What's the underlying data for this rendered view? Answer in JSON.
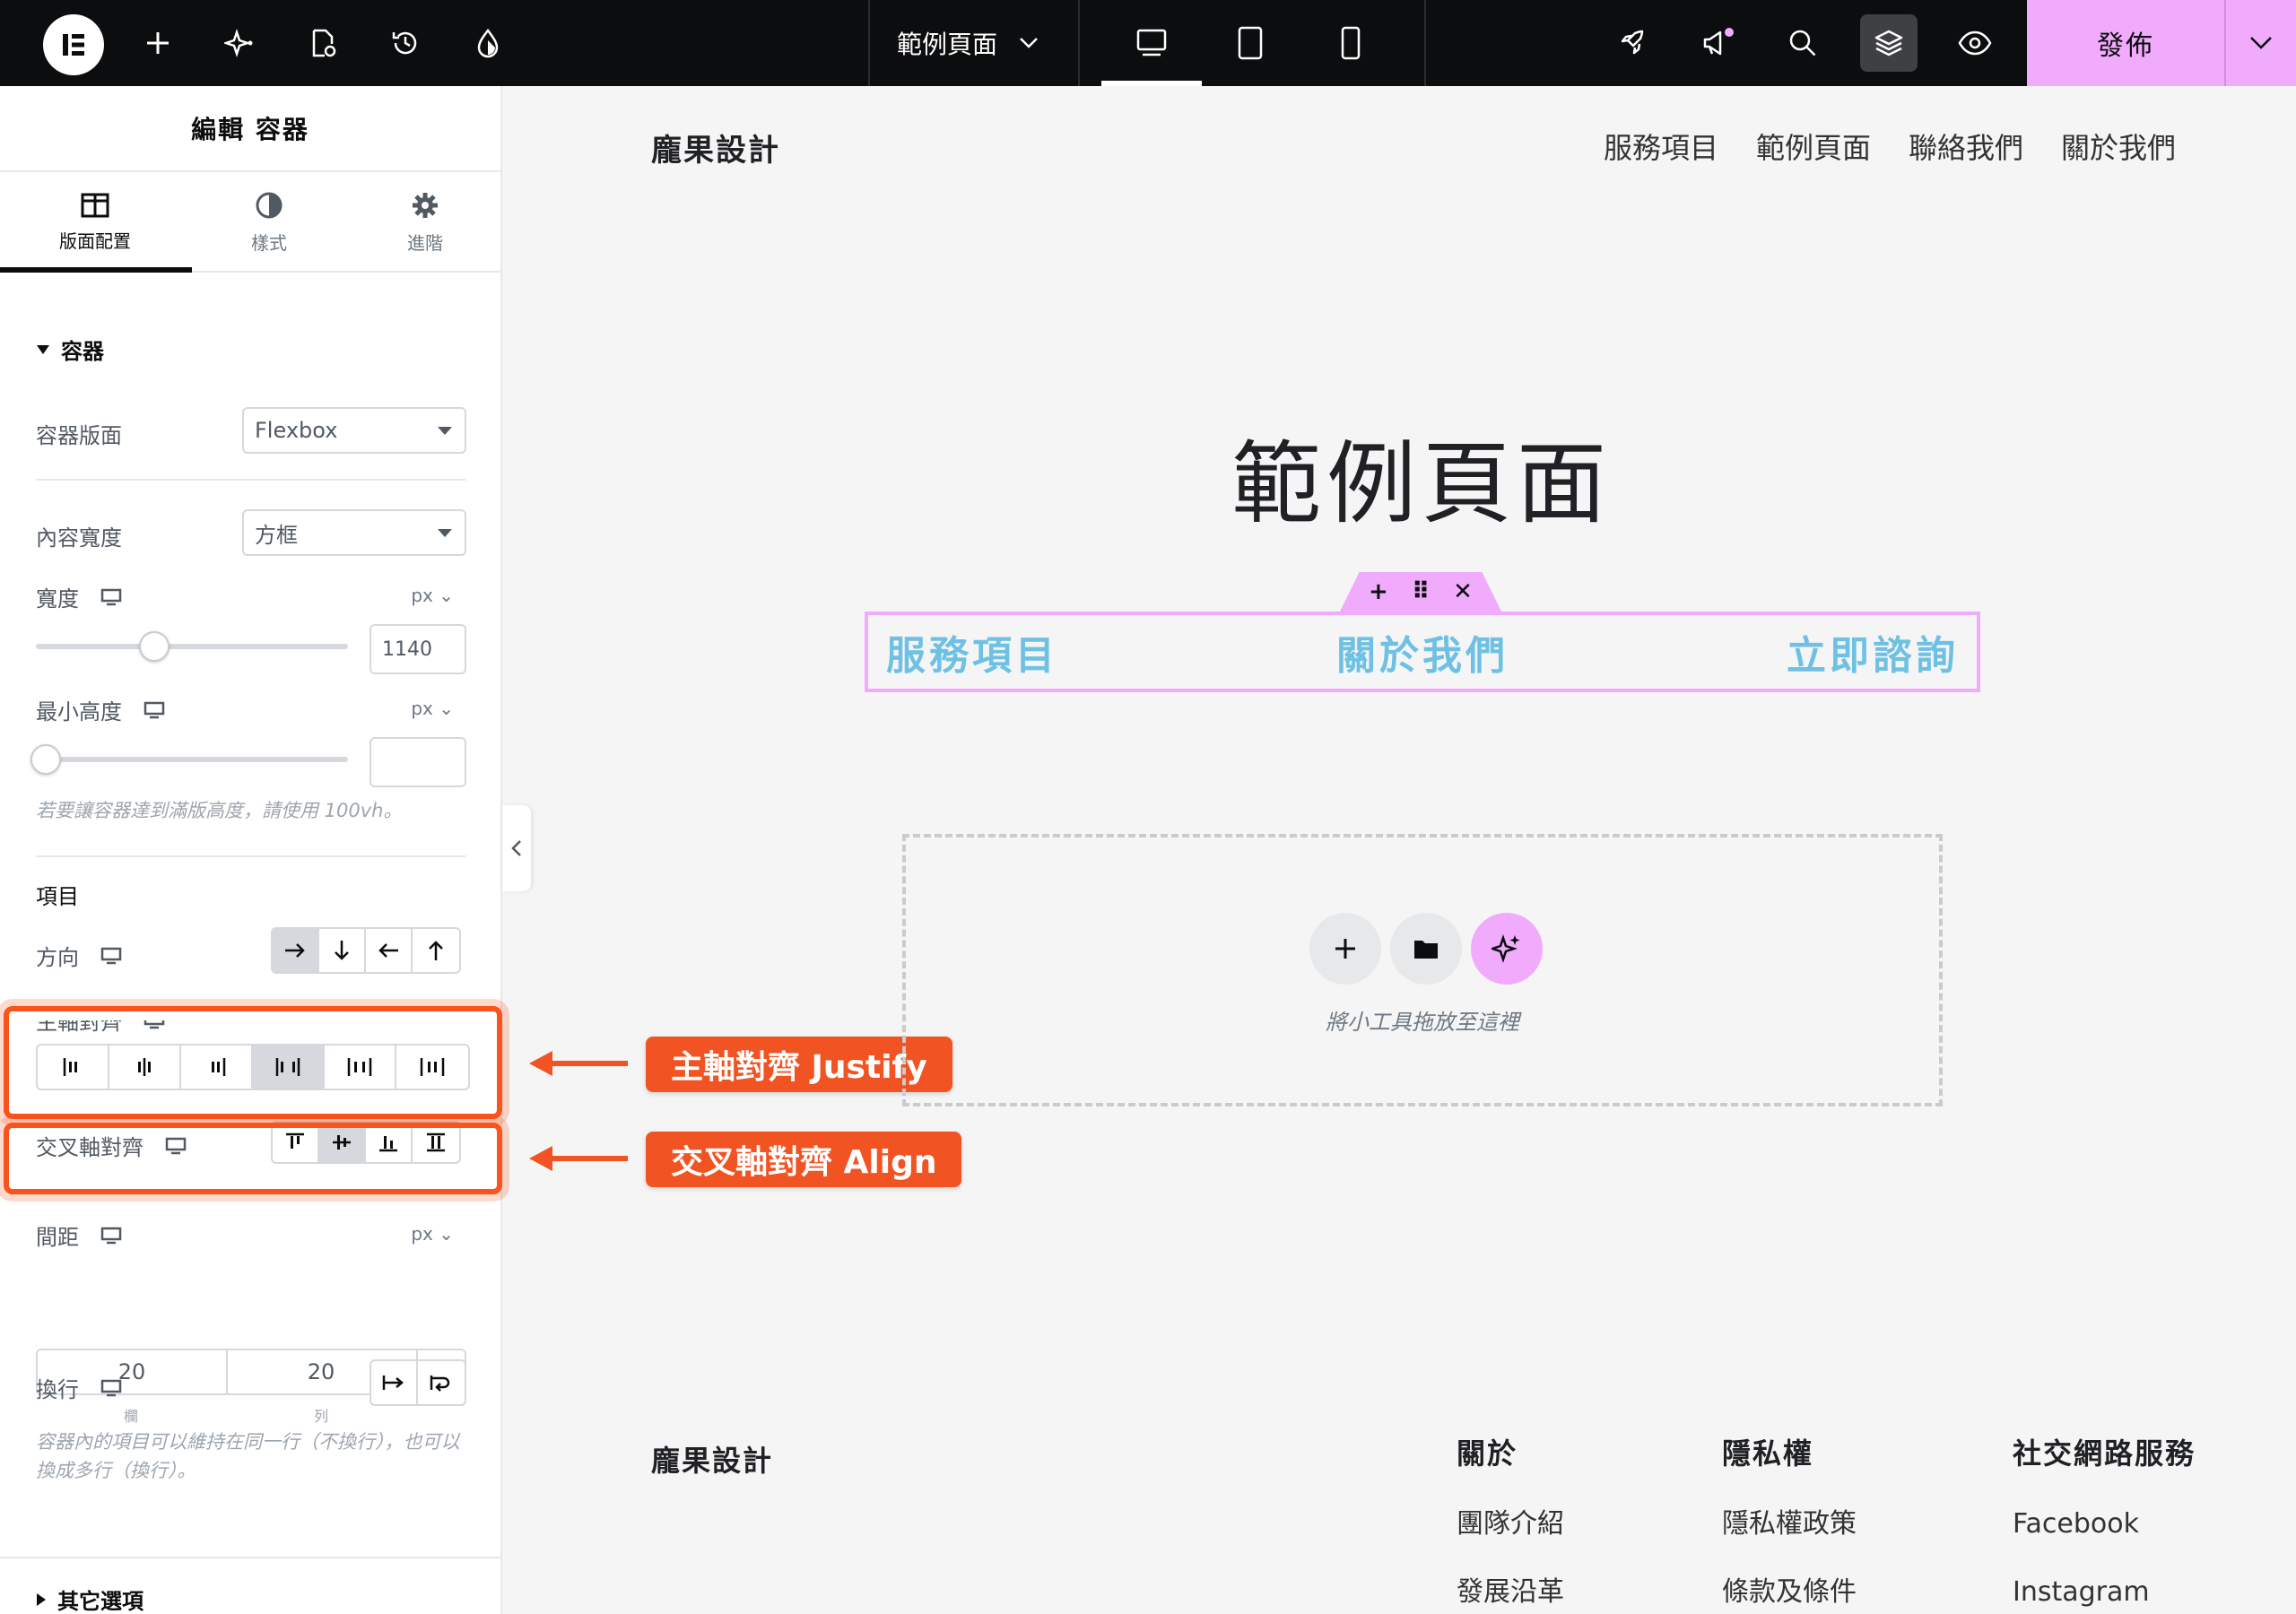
{
  "topbar": {
    "page_name": "範例頁面",
    "publish_label": "發佈"
  },
  "panel": {
    "title": "編輯 容器",
    "tabs": [
      {
        "label": "版面配置",
        "icon": "layout-icon",
        "active": true
      },
      {
        "label": "樣式",
        "icon": "style-icon",
        "active": false
      },
      {
        "label": "進階",
        "icon": "gear-icon",
        "active": false
      }
    ],
    "section_title": "容器",
    "container_layout": {
      "label": "容器版面",
      "value": "Flexbox"
    },
    "content_width": {
      "label": "內容寬度",
      "value": "方框"
    },
    "width": {
      "label": "寬度",
      "unit": "px",
      "value": "1140",
      "slider_fraction": 0.38
    },
    "min_height": {
      "label": "最小高度",
      "unit": "px",
      "value": "",
      "slider_fraction": 0.0,
      "hint": "若要讓容器達到滿版高度，請使用 100vh。"
    },
    "items_title": "項目",
    "direction": {
      "label": "方向",
      "selected": "row"
    },
    "justify": {
      "label": "主軸對齊",
      "selected_index": 3
    },
    "align": {
      "label": "交叉軸對齊",
      "selected_index": 1
    },
    "gap": {
      "label": "間距",
      "unit": "px",
      "column": "20",
      "row": "20",
      "column_label": "欄",
      "row_label": "列"
    },
    "wrap": {
      "label": "換行",
      "hint": "容器內的項目可以維持在同一行（不換行），也可以換成多行（換行）。"
    },
    "other_section": "其它選項"
  },
  "callouts": {
    "justify": "主軸對齊 Justify",
    "align": "交叉軸對齊 Align"
  },
  "site": {
    "brand": "龐果設計",
    "nav": [
      "服務項目",
      "範例頁面",
      "聯絡我們",
      "關於我們"
    ],
    "hero_title": "範例頁面",
    "container_links": [
      "服務項目",
      "關於我們",
      "立即諮詢"
    ],
    "drop_hint": "將小工具拖放至這裡",
    "footer": {
      "brand": "龐果設計",
      "columns": [
        {
          "heading": "關於",
          "items": [
            "團隊介紹",
            "發展沿革"
          ]
        },
        {
          "heading": "隱私權",
          "items": [
            "隱私權政策",
            "條款及條件"
          ]
        },
        {
          "heading": "社交網路服務",
          "items": [
            "Facebook",
            "Instagram"
          ]
        }
      ]
    }
  },
  "colors": {
    "accent_pink": "#f0abfc",
    "link_blue": "#6ec1e4",
    "callout_orange": "#f25322"
  }
}
